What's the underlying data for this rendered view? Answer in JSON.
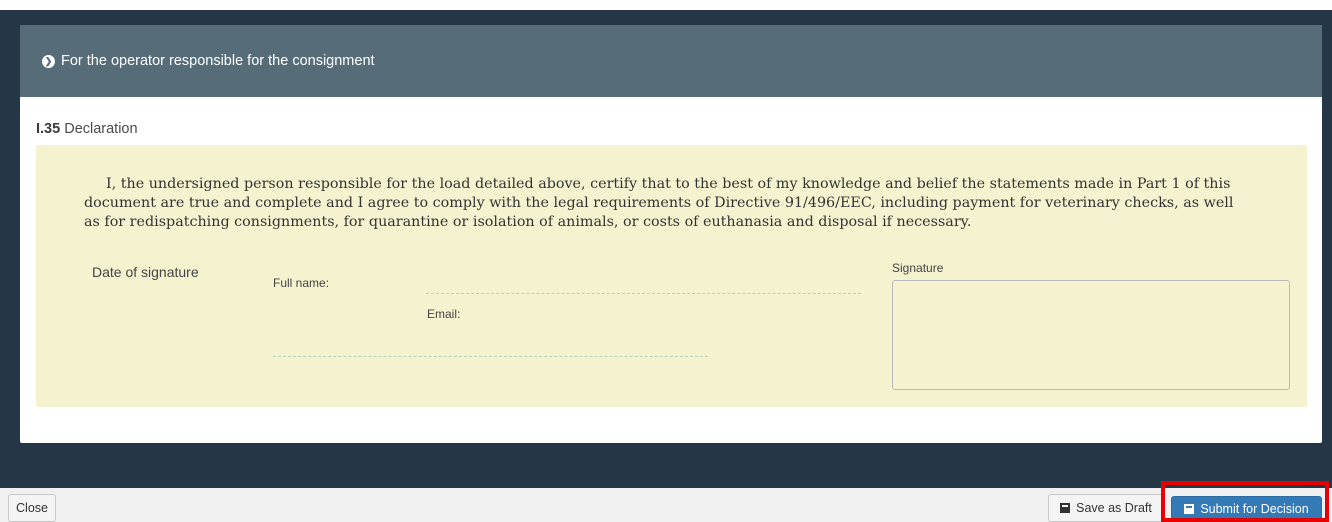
{
  "panel": {
    "header_icon": "circle-arrow-right-icon",
    "header_title": "For the operator responsible for the consignment",
    "section_code": "I.35",
    "section_title": "Declaration"
  },
  "declaration": {
    "text": "I, the undersigned person responsible for the load detailed above, certify that to the best of my knowledge and belief the statements made in Part 1 of this document are true and complete and I agree to comply with the legal requirements of Directive 91/496/EEC, including payment for veterinary checks, as well as for redispatching consignments, for quarantine or isolation of animals, or costs of euthanasia and disposal if necessary.",
    "date_label": "Date of signature",
    "fullname_label": "Full name:",
    "email_label": "Email:",
    "signature_label": "Signature",
    "background_color": "#f5f3cf"
  },
  "footer": {
    "close_label": "Close",
    "save_draft_label": "Save as Draft",
    "save_draft_icon": "archive-icon",
    "submit_label": "Submit for Decision",
    "submit_icon": "archive-icon",
    "submit_color": "#337ab7",
    "highlight_color": "#e60000"
  }
}
